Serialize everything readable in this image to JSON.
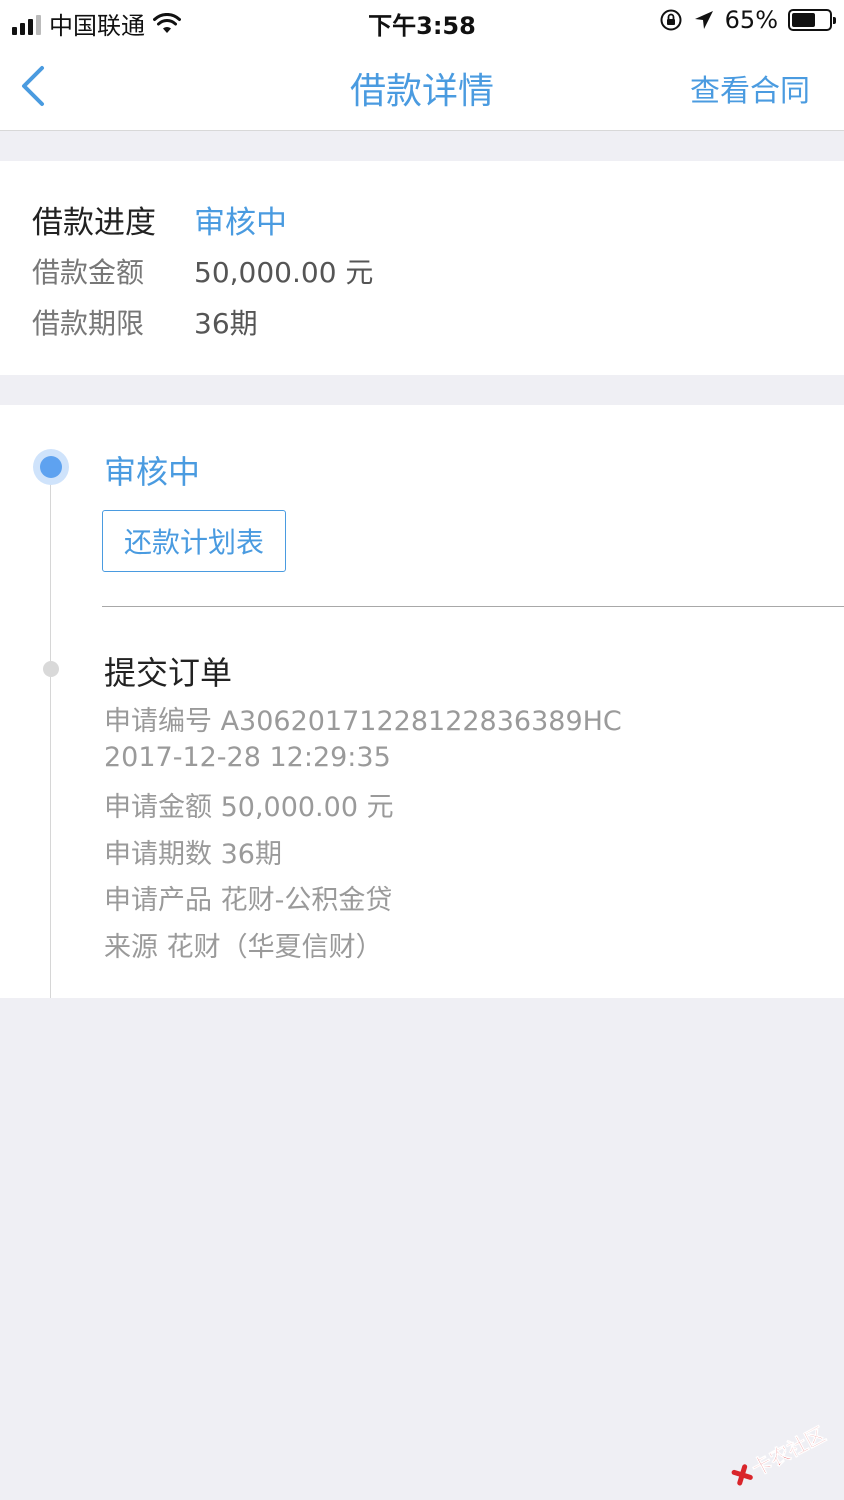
{
  "status_bar": {
    "carrier": "中国联通",
    "time": "下午3:58",
    "battery": "65%",
    "battery_level": 0.65
  },
  "nav": {
    "title": "借款详情",
    "right_link": "查看合同"
  },
  "summary": {
    "progress_label": "借款进度",
    "progress_value": "审核中",
    "amount_label": "借款金额",
    "amount_value": "50,000.00 元",
    "term_label": "借款期限",
    "term_value": "36期"
  },
  "timeline": {
    "active_step": {
      "title": "审核中",
      "button_label": "还款计划表"
    },
    "submitted_step": {
      "title": "提交订单",
      "lines": [
        "申请编号 A30620171228122836389HC",
        "2017-12-28 12:29:35",
        "申请金额 50,000.00 元",
        "申请期数 36期",
        "申请产品 花财-公积金贷",
        "来源 花财（华夏信财）"
      ]
    }
  },
  "watermark": {
    "text": "卡农社区",
    "color": "#d9252b"
  },
  "colors": {
    "accent": "#4a9be0",
    "background": "#efeff4",
    "muted_text": "#9a9a9a"
  }
}
